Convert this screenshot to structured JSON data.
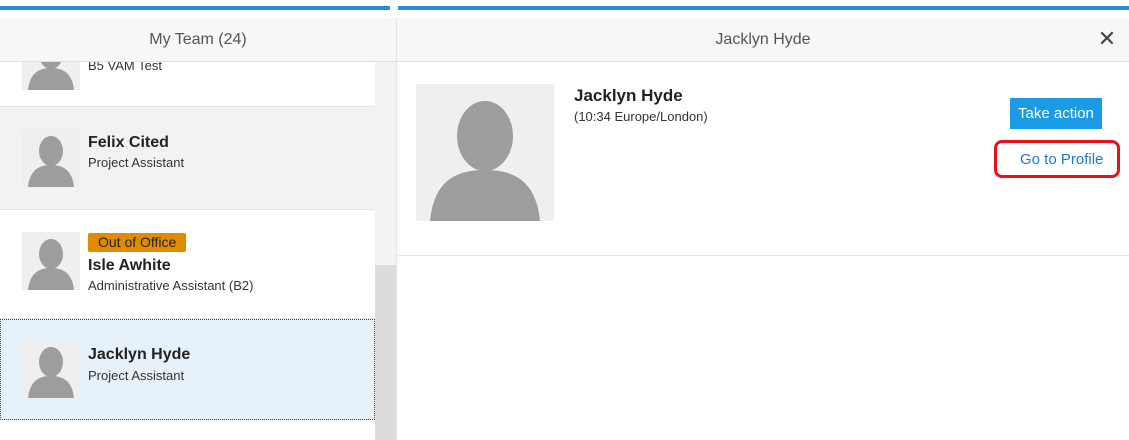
{
  "left_panel": {
    "header": "My Team (24)",
    "partial_item_role": "B5 VAM Test",
    "items": [
      {
        "name": "Felix Cited",
        "role": "Project Assistant"
      },
      {
        "badge": "Out of Office",
        "name": "Isle Awhite",
        "role": "Administrative Assistant (B2)"
      },
      {
        "name": "Jacklyn Hyde",
        "role": "Project Assistant",
        "selected": true
      }
    ]
  },
  "right_panel": {
    "header": "Jacklyn Hyde",
    "close_icon": "close-icon",
    "person": {
      "name": "Jacklyn Hyde",
      "local_time": "(10:34 Europe/London)"
    },
    "actions": {
      "take_action": "Take action",
      "go_to_profile": "Go to Profile"
    }
  },
  "colors": {
    "accent_blue": "#1a9be6",
    "link_blue": "#1a7ad4",
    "highlight_red": "#e4131b",
    "badge_orange": "#e08c00",
    "selected_row": "#e6f1fa",
    "hover_row": "#f2f2f2"
  }
}
